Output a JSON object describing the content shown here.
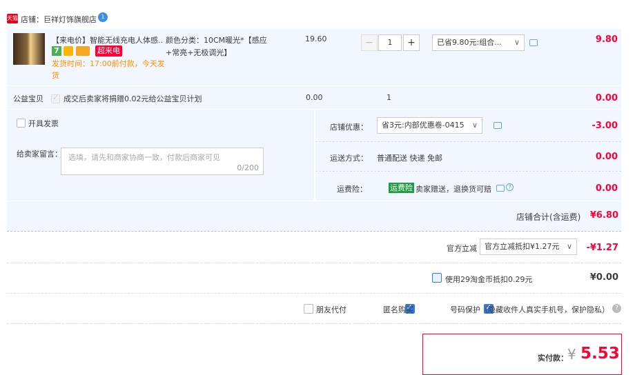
{
  "shop": {
    "badge": "天猫",
    "name": "店铺：巨祥灯饰旗舰店",
    "badge_count": "1"
  },
  "item": {
    "title": "【来电价】智能无线充电人体感...",
    "tag_seven": "7",
    "tag_super": "超来电",
    "ship": "发货时间：17:00前付款，今天发货",
    "spec": "颜色分类：10CM暖光*【感应+常亮+无极调光】",
    "price": "19.60",
    "qty": "1",
    "qty_minus": "−",
    "qty_plus": "+",
    "discount": "已省9.80元:组合...",
    "subtotal": "9.80"
  },
  "charity": {
    "label": "公益宝贝",
    "text": "成交后卖家将捐赠0.02元给公益宝贝计划",
    "price": "0.00",
    "qty": "1",
    "total": "0.00"
  },
  "invoice": {
    "label": "开具发票"
  },
  "message": {
    "label": "给卖家留言：",
    "placeholder": "选填，请先和商家协商一致，付款后商家可见",
    "count": "0/200"
  },
  "coupon": {
    "label": "店铺优惠：",
    "value": "省3元:内部优惠卷-0415",
    "amount": "-3.00"
  },
  "shipping": {
    "label": "运送方式：",
    "value": "普通配送 快递 免邮",
    "amount": "0.00"
  },
  "insurance": {
    "label": "运费险：",
    "tag": "运费险",
    "text": "卖家赠送，退换货可赔",
    "amount": "0.00"
  },
  "shop_total": {
    "label": "店铺合计(含运费)",
    "amount": "¥6.80"
  },
  "official": {
    "label": "官方立减",
    "value": "官方立减抵扣¥1.27元",
    "amount": "-¥1.27"
  },
  "coins": {
    "label": "使用29淘金币抵扣0.29元",
    "amount": "¥0.00"
  },
  "options": {
    "friend": "朋友代付",
    "anon": "匿名购买",
    "privacy": "号码保护（隐藏收件人真实手机号，保护隐私）"
  },
  "pay": {
    "label": "实付款：",
    "currency": "¥",
    "amount": "5.53"
  },
  "colors": {
    "accent": "#ff0036",
    "brand": "#3a75d9"
  }
}
